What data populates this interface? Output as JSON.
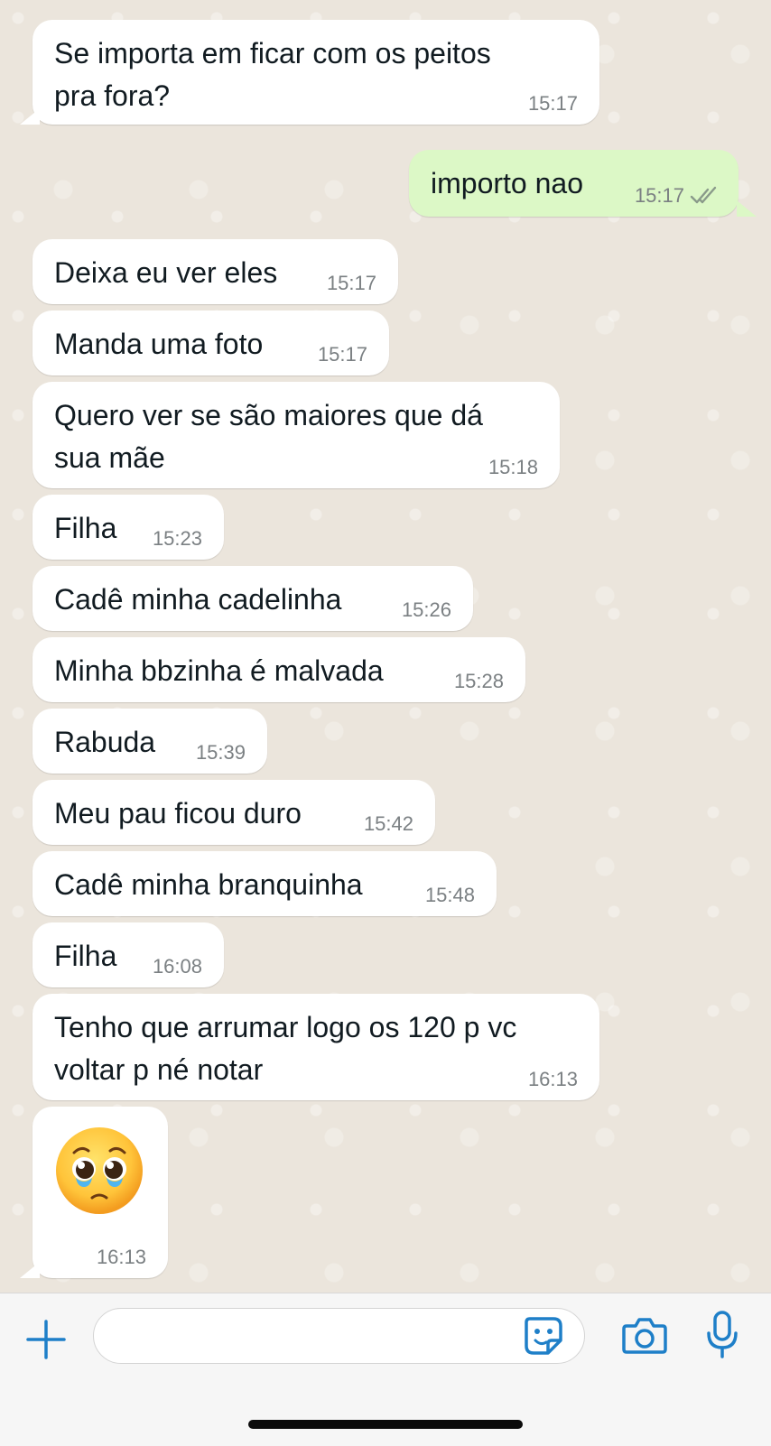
{
  "conversation": {
    "messages": [
      {
        "dir": "in",
        "text": "Se importa em ficar com os peitos\npra fora?",
        "time": "15:17"
      },
      {
        "dir": "out",
        "text": "importo nao",
        "time": "15:17",
        "status": "read"
      },
      {
        "dir": "in",
        "text": "Deixa eu ver eles",
        "time": "15:17"
      },
      {
        "dir": "in",
        "text": "Manda uma foto",
        "time": "15:17"
      },
      {
        "dir": "in",
        "text": "Quero ver se são maiores que dá\nsua mãe",
        "time": "15:18"
      },
      {
        "dir": "in",
        "text": "Filha",
        "time": "15:23"
      },
      {
        "dir": "in",
        "text": "Cadê minha cadelinha",
        "time": "15:26"
      },
      {
        "dir": "in",
        "text": "Minha bbzinha é malvada",
        "time": "15:28"
      },
      {
        "dir": "in",
        "text": "Rabuda",
        "time": "15:39"
      },
      {
        "dir": "in",
        "text": "Meu pau ficou duro",
        "time": "15:42"
      },
      {
        "dir": "in",
        "text": "Cadê minha branquinha",
        "time": "15:48"
      },
      {
        "dir": "in",
        "text": "Filha",
        "time": "16:08"
      },
      {
        "dir": "in",
        "text": "Tenho que arrumar logo os 120 p vc\nvoltar p né notar",
        "time": "16:13"
      },
      {
        "dir": "in",
        "emoji": "pleading-face-with-tears",
        "time": "16:13"
      }
    ]
  },
  "composer": {
    "text_value": "",
    "icons": [
      "plus-icon",
      "sticker-icon",
      "camera-icon",
      "microphone-icon"
    ]
  },
  "colors": {
    "incoming_bubble": "#ffffff",
    "outgoing_bubble": "#dcf8c6",
    "accent": "#1e7fc8",
    "chat_background": "#ebe5dc"
  }
}
